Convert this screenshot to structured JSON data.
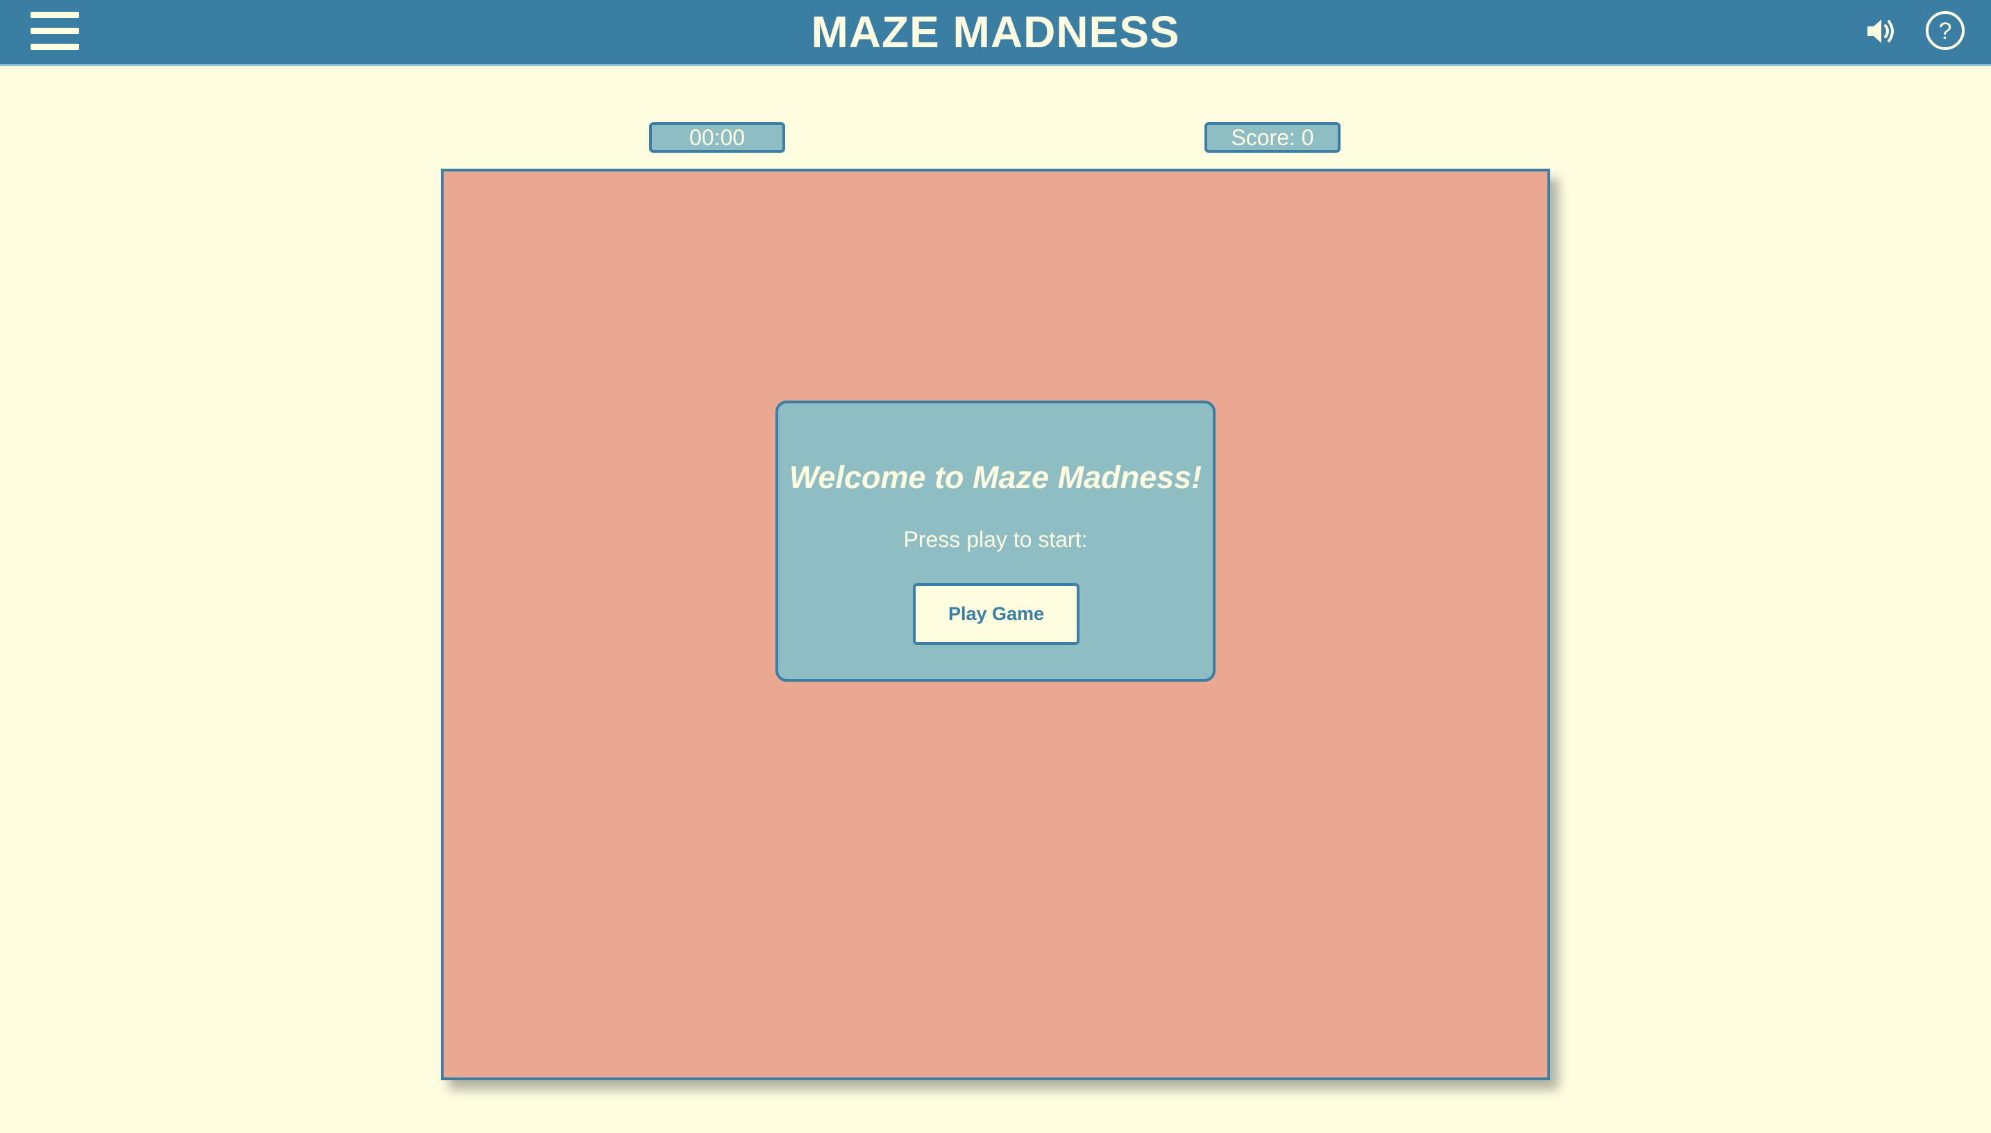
{
  "header": {
    "title": "MAZE MADNESS",
    "menu_icon": "hamburger-menu-icon",
    "sound_icon": "speaker-volume-icon",
    "help_icon": "question-mark-circle-icon",
    "help_glyph": "?"
  },
  "hud": {
    "timer": "00:00",
    "score": "Score: 0"
  },
  "dialog": {
    "title": "Welcome to Maze Madness!",
    "subtitle": "Press play to start:",
    "play_label": "Play Game"
  },
  "colors": {
    "background": "#FEFDE0",
    "header": "#3A7EA4",
    "maze_area": "#EAA792",
    "panel": "#8EBDC4",
    "text_light": "#FEFDE0",
    "accent": "#3A7EA4"
  }
}
